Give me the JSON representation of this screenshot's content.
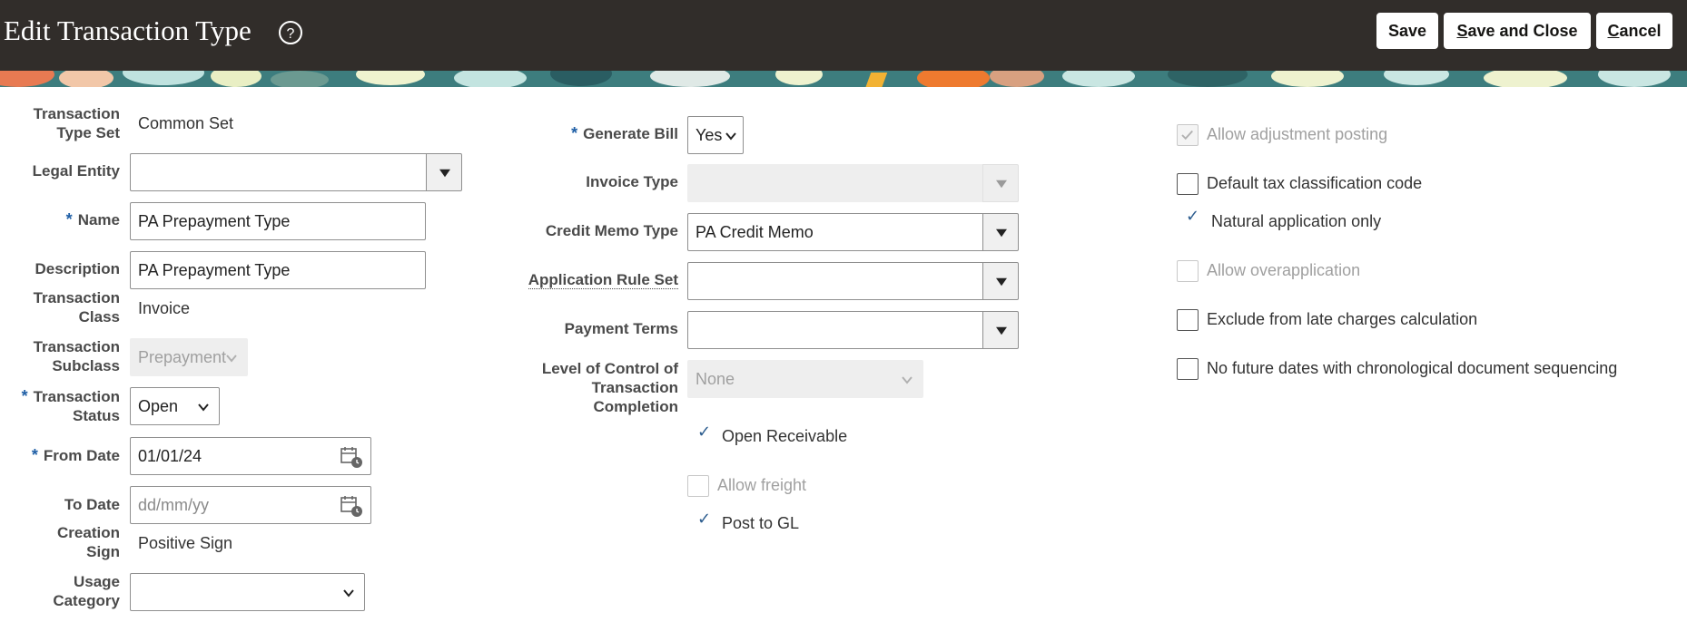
{
  "header": {
    "title": "Edit Transaction Type",
    "buttons": {
      "save": "Save",
      "save_close_first": "S",
      "save_close_rest": "ave and Close",
      "cancel_first": "C",
      "cancel_rest": "ancel"
    }
  },
  "col1": {
    "transaction_type_set": {
      "label1": "Transaction",
      "label2": "Type Set",
      "value": "Common Set"
    },
    "legal_entity": {
      "label": "Legal Entity",
      "value": ""
    },
    "name": {
      "label": "Name",
      "value": "PA Prepayment Type"
    },
    "description": {
      "label": "Description",
      "value": "PA Prepayment Type"
    },
    "transaction_class": {
      "label1": "Transaction",
      "label2": "Class",
      "value": "Invoice"
    },
    "transaction_subclass": {
      "label1": "Transaction",
      "label2": "Subclass",
      "value": "Prepayment"
    },
    "transaction_status": {
      "label1": "Transaction",
      "label2": "Status",
      "value": "Open"
    },
    "from_date": {
      "label": "From Date",
      "value": "01/01/24"
    },
    "to_date": {
      "label": "To Date",
      "placeholder": "dd/mm/yy"
    },
    "creation_sign": {
      "label1": "Creation",
      "label2": "Sign",
      "value": "Positive Sign"
    },
    "usage_category": {
      "label1": "Usage",
      "label2": "Category",
      "value": ""
    }
  },
  "col2": {
    "generate_bill": {
      "label": "Generate Bill",
      "value": "Yes"
    },
    "invoice_type": {
      "label": "Invoice Type",
      "value": ""
    },
    "credit_memo_type": {
      "label": "Credit Memo Type",
      "value": "PA Credit Memo"
    },
    "application_rule_set": {
      "label": "Application Rule Set",
      "value": ""
    },
    "payment_terms": {
      "label": "Payment Terms",
      "value": ""
    },
    "level_of_control": {
      "label1": "Level of Control of",
      "label2": "Transaction",
      "label3": "Completion",
      "value": "None"
    },
    "open_receivable": {
      "label": "Open Receivable",
      "checked": true
    },
    "allow_freight": {
      "label": "Allow freight",
      "checked": false
    },
    "post_to_gl": {
      "label": "Post to GL",
      "checked": true
    }
  },
  "col3": {
    "allow_adjustment_posting": {
      "label": "Allow adjustment posting",
      "checked": true,
      "disabled": true
    },
    "default_tax_classification": {
      "label": "Default tax classification code",
      "checked": false
    },
    "natural_application_only": {
      "label": "Natural application only",
      "checked": true
    },
    "allow_overapplication": {
      "label": "Allow overapplication",
      "checked": false,
      "disabled": true
    },
    "exclude_late_charges": {
      "label": "Exclude from late charges calculation",
      "checked": false
    },
    "no_future_dates": {
      "label": "No future dates with chronological document sequencing",
      "checked": false
    }
  },
  "colors": {
    "header_bg": "#312d2a",
    "required_marker": "#1f5fa6",
    "check_mark": "#2d5d8f",
    "disabled_bg": "#eeeeee"
  },
  "required_marker": "*",
  "check_glyph": "✓"
}
